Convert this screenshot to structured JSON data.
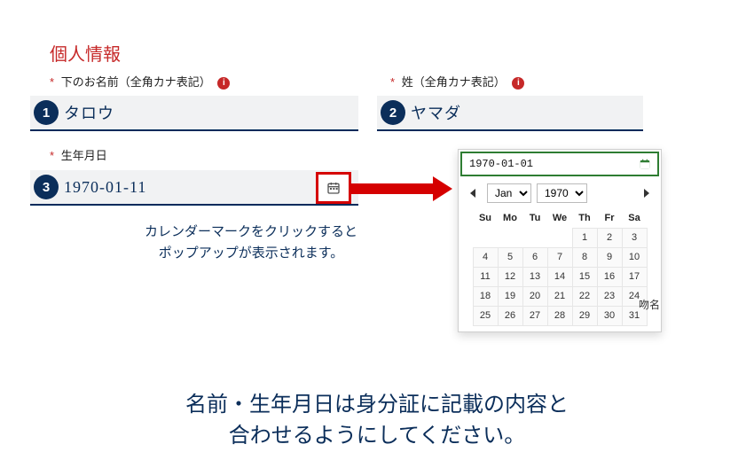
{
  "section_title": "個人情報",
  "labels": {
    "first_name": "下のお名前（全角カナ表記）",
    "last_name": "姓（全角カナ表記）",
    "dob": "生年月日",
    "required": "*"
  },
  "badges": {
    "one": "1",
    "two": "2",
    "three": "3"
  },
  "inputs": {
    "first_name_value": "タロウ",
    "last_name_value": "ヤマダ",
    "dob_value": "1970-01-11"
  },
  "picker": {
    "input_value": "1970-01-01",
    "month": "Jan",
    "year": "1970",
    "weekdays": [
      "Su",
      "Mo",
      "Tu",
      "We",
      "Th",
      "Fr",
      "Sa"
    ],
    "weeks": [
      [
        "",
        "",
        "",
        "",
        "1",
        "2",
        "3"
      ],
      [
        "4",
        "5",
        "6",
        "7",
        "8",
        "9",
        "10"
      ],
      [
        "11",
        "12",
        "13",
        "14",
        "15",
        "16",
        "17"
      ],
      [
        "18",
        "19",
        "20",
        "21",
        "22",
        "23",
        "24"
      ],
      [
        "25",
        "26",
        "27",
        "28",
        "29",
        "30",
        "31"
      ]
    ]
  },
  "hint": {
    "line1": "カレンダーマークをクリックすると",
    "line2": "ポップアップが表示されます。"
  },
  "note": {
    "line1": "名前・生年月日は身分証に記載の内容と",
    "line2": "合わせるようにしてください。"
  },
  "side_label": "吻名",
  "colors": {
    "accent_red": "#d50000",
    "dark_navy": "#0b2e5a",
    "green_focus": "#2e7d32",
    "heading_red": "#c62828"
  }
}
